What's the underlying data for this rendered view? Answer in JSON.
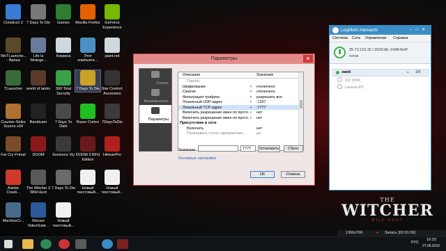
{
  "desktop": {
    "icons": [
      {
        "label": "Construct 2",
        "color": "#3a7bd5"
      },
      {
        "label": "7 Days To Die",
        "color": "#777777"
      },
      {
        "label": "Games",
        "color": "#2e7d32"
      },
      {
        "label": "Mozilla Firefox",
        "color": "#e66000"
      },
      {
        "label": "GeForce Experience",
        "color": "#76b900"
      },
      {
        "label": "WoTLaunche... - Ярлык",
        "color": "#5a4a2a"
      },
      {
        "label": "Life Is Strange...",
        "color": "#6a7a9a"
      },
      {
        "label": "Корзина",
        "color": "#cfd8dc"
      },
      {
        "label": "Этот компьюте...",
        "color": "#4a90c0"
      },
      {
        "label": "paint.net",
        "color": "#d0d8e0"
      },
      {
        "label": "TLauncher",
        "color": "#3a6a3a"
      },
      {
        "label": "world of tanks",
        "color": "#5a3a2a"
      },
      {
        "label": "360 Total Security",
        "color": "#3aa04a"
      },
      {
        "label": "7 Days To Die",
        "color": "#c9a227"
      },
      {
        "label": "Star Control: Ascension",
        "color": "#333333"
      },
      {
        "label": "Counter-Strike Source v34",
        "color": "#b07030"
      },
      {
        "label": "Bandicam",
        "color": "#222222"
      },
      {
        "label": "7 Days To Dark",
        "color": "#4a4a4a"
      },
      {
        "label": "Razer Cortex",
        "color": "#20c020"
      },
      {
        "label": "7DaysToDie",
        "color": "#3a3a3a"
      },
      {
        "label": "Far Cry Primal",
        "color": "#7a4a2a"
      },
      {
        "label": "DOOM",
        "color": "#8a1a1a"
      },
      {
        "label": "Survivors Viy",
        "color": "#3a3a3a"
      },
      {
        "label": "DOOM 3 BFG Edition",
        "color": "#6a1a1a"
      },
      {
        "label": "HitmanPro",
        "color": "#b02020"
      },
      {
        "label": "Adobe Creati...",
        "color": "#d03a2a"
      },
      {
        "label": "The Witcher 3 Wild Hunt",
        "color": "#5a5a5a"
      },
      {
        "label": "7 Days To Die",
        "color": "#6a6a6a"
      },
      {
        "label": "Новый текстовый...",
        "color": "#f0f0f0"
      },
      {
        "label": "Новый текстовый...",
        "color": "#f0f0f0"
      },
      {
        "label": "MachineCr...",
        "color": "#4a6a8a"
      },
      {
        "label": "Movavi VideoSuite...",
        "color": "#2a5a9a"
      },
      {
        "label": "Новый текстовый...",
        "color": "#f0f0f0"
      }
    ]
  },
  "dialog": {
    "title": "Параметры",
    "sidebar": [
      "Статус",
      "Безопасность",
      "Параметры"
    ],
    "columns": {
      "name": "Описание",
      "value": "Значение"
    },
    "rows": [
      {
        "name": "Пароль",
        "value": "",
        "type": "gray",
        "dot": false
      },
      {
        "name": "Шифрование",
        "value": "отключено",
        "type": "",
        "dot": true
      },
      {
        "name": "Сжатие",
        "value": "отключено",
        "type": "",
        "dot": true
      },
      {
        "name": "Фильтрация трафика",
        "value": "разрешить все",
        "type": "",
        "dot": true
      },
      {
        "name": "Локальный UDP-адрес",
        "value": ":1337",
        "type": "",
        "dot": true
      },
      {
        "name": "Локальный TCP-адрес",
        "value": ":7777",
        "type": "sel",
        "dot": true
      },
      {
        "name": "Включить разрешение имен по прото...",
        "value": "нет",
        "type": "",
        "dot": true
      },
      {
        "name": "Включить разрешение имен по прото...",
        "value": "нет",
        "type": "",
        "dot": true
      },
      {
        "name": "Присутствие в сети",
        "value": "",
        "type": "sec",
        "dot": false
      },
      {
        "name": "Включить",
        "value": "нет",
        "type": "",
        "dot": false
      },
      {
        "name": "Показывать статус одноранговo...",
        "value": "да",
        "type": "gray",
        "dot": false
      }
    ],
    "value_label": "Значение",
    "value_input": "",
    "port_input": "7777",
    "set_button": "Установить",
    "reset_button": "Сброс",
    "basic_settings_link": "Основные настройки",
    "ok_button": "ОК",
    "cancel_button": "Отмена"
  },
  "hamachi": {
    "title": "LogMeIn Hamachi",
    "menu": [
      "Система",
      "Сеть",
      "Управление",
      "Справка"
    ],
    "ip": "25.72.110.15 / 2620:9b::1948:6e0f",
    "status": "готов",
    "network": {
      "name": "змей",
      "count": "3/5"
    },
    "peers": [
      "111 ONS",
      "Lenovo-PC"
    ]
  },
  "wallpaper": {
    "line1": "THE",
    "line2": "WITCHER",
    "line3": "WILD HUNT"
  },
  "recording": {
    "resolution": "1366x768",
    "status": "Запись [00:01:06]"
  },
  "taskbar": {
    "lang": "РУС",
    "time": "16:33",
    "date": "27.06.2016"
  }
}
